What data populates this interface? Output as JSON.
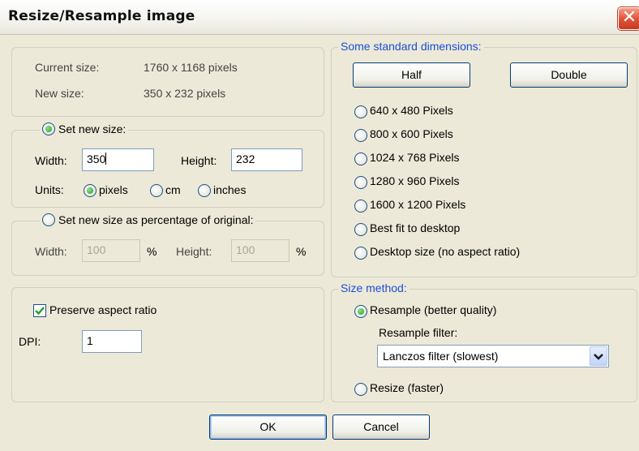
{
  "window": {
    "title": "Resize/Resample image",
    "close_glyph": "✕"
  },
  "size_info": {
    "current_label": "Current size:",
    "current_value": "1760  x  1168  pixels",
    "new_label": "New size:",
    "new_value": "350  x  232  pixels"
  },
  "new_size": {
    "radio_label": "Set new size:",
    "selected": true,
    "width_label": "Width:",
    "width_value": "350",
    "height_label": "Height:",
    "height_value": "232",
    "units_label": "Units:",
    "units": [
      {
        "label": "pixels",
        "selected": true
      },
      {
        "label": "cm",
        "selected": false
      },
      {
        "label": "inches",
        "selected": false
      }
    ]
  },
  "percentage": {
    "radio_label": "Set new size as percentage of original:",
    "selected": false,
    "width_label": "Width:",
    "width_value": "100",
    "height_label": "Height:",
    "height_value": "100",
    "percent_sign": "%"
  },
  "aspect": {
    "checkbox_label": "Preserve aspect ratio",
    "checked": true,
    "dpi_label": "DPI:",
    "dpi_value": "1"
  },
  "standard": {
    "legend": "Some standard dimensions:",
    "half_button": "Half",
    "double_button": "Double",
    "options": [
      "640 x 480 Pixels",
      "800 x 600 Pixels",
      "1024 x 768 Pixels",
      "1280 x 960 Pixels",
      "1600 x 1200 Pixels",
      "Best fit to desktop",
      "Desktop size (no aspect ratio)"
    ]
  },
  "method": {
    "legend": "Size method:",
    "resample_label": "Resample (better quality)",
    "resample_selected": true,
    "filter_label": "Resample filter:",
    "filter_value": "Lanczos filter (slowest)",
    "resize_label": "Resize (faster)",
    "resize_selected": false
  },
  "buttons": {
    "ok": "OK",
    "cancel": "Cancel"
  },
  "colors": {
    "legend_blue": "#1c4fd8",
    "dialog_bg": "#ece9d8",
    "close_red": "#e0553a"
  }
}
